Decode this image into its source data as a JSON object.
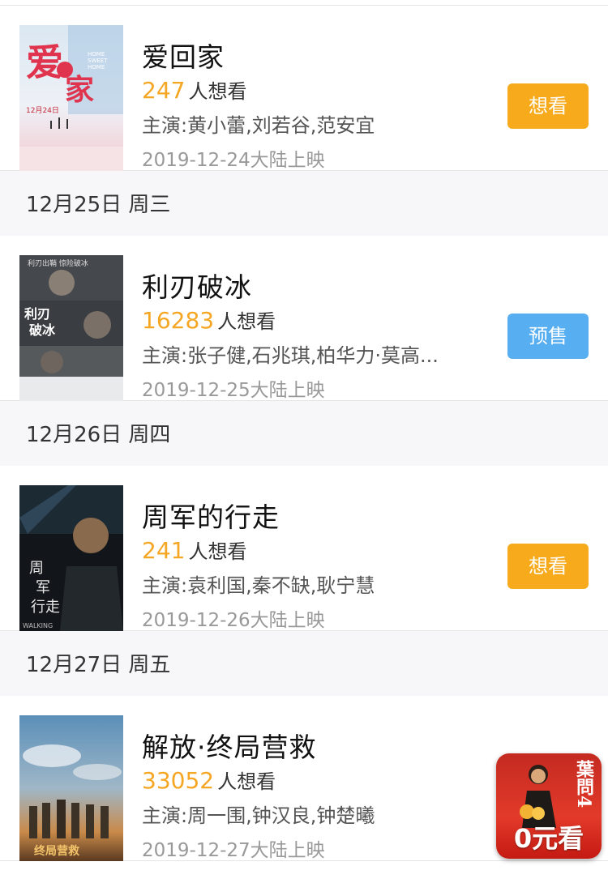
{
  "sections": [
    {
      "date_header": "",
      "movie": {
        "title": "爱回家",
        "want_count": "247",
        "want_suffix": "人想看",
        "cast": "主演:黄小蕾,刘若谷,范安宜",
        "release": "2019-12-24大陆上映",
        "button_label": "想看",
        "button_type": "want",
        "poster_text": "爱回家",
        "poster_sub": "HOME SWEET HOME",
        "poster_date": "12月24日"
      }
    },
    {
      "date_header": "12月25日 周三",
      "movie": {
        "title": "利刃破冰",
        "want_count": "16283",
        "want_suffix": "人想看",
        "cast": "主演:张子健,石兆琪,柏华力·莫高...",
        "release": "2019-12-25大陆上映",
        "button_label": "预售",
        "button_type": "presale",
        "poster_text": "利刃破冰",
        "poster_top": "利刃出鞘 惊险破冰"
      }
    },
    {
      "date_header": "12月26日 周四",
      "movie": {
        "title": "周军的行走",
        "want_count": "241",
        "want_suffix": "人想看",
        "cast": "主演:袁利国,秦不缺,耿宁慧",
        "release": "2019-12-26大陆上映",
        "button_label": "想看",
        "button_type": "want",
        "poster_text": "周军的行走",
        "poster_sub": "WALKING"
      }
    },
    {
      "date_header": "12月27日 周五",
      "movie": {
        "title": "解放·终局营救",
        "want_count": "33052",
        "want_suffix": "人想看",
        "cast": "主演:周一围,钟汉良,钟楚曦",
        "release": "2019-12-27大陆上映",
        "button_label": "",
        "button_type": "none",
        "poster_text": "终局营救"
      }
    }
  ],
  "float_ad": {
    "label": "0元看",
    "vertical_text": "葉問4"
  },
  "colors": {
    "want_count": "#f5a623",
    "want_button": "#f7ab1c",
    "presale_button": "#57aef0",
    "header_bg": "#f7f7f9"
  }
}
